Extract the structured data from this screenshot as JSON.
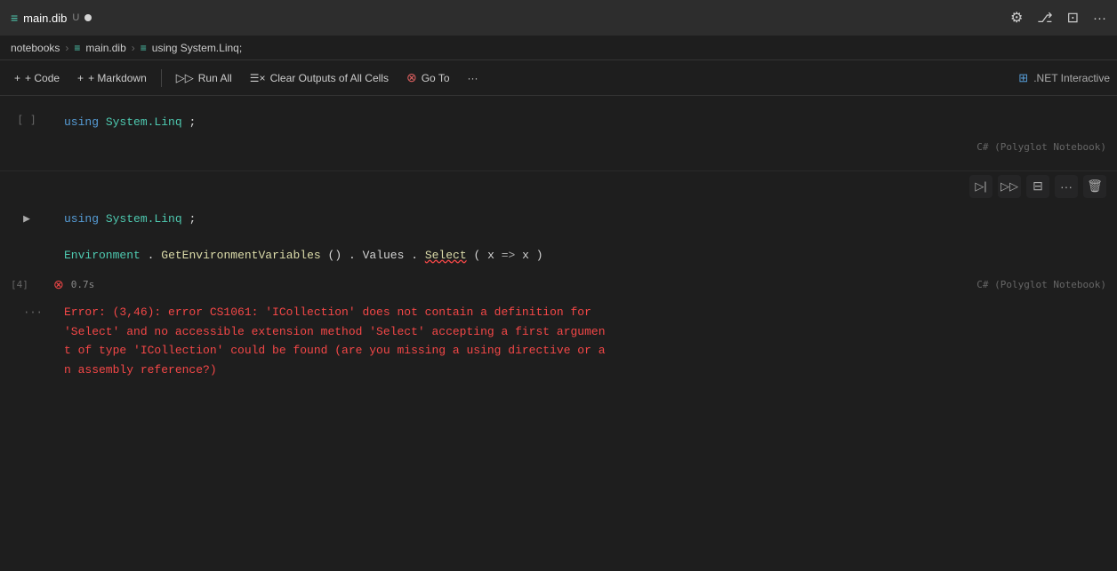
{
  "titlebar": {
    "filename": "main.dib",
    "modified_flag": "U",
    "icons": [
      "gear-icon",
      "branch-icon",
      "layout-icon",
      "more-icon"
    ]
  },
  "breadcrumb": {
    "items": [
      "notebooks",
      "main.dib",
      "using System.Linq;"
    ],
    "separators": [
      ">",
      ">"
    ]
  },
  "toolbar": {
    "add_code_label": "+ Code",
    "add_markdown_label": "+ Markdown",
    "run_all_label": "Run All",
    "clear_outputs_label": "Clear Outputs of All Cells",
    "goto_label": "Go To",
    "more_label": "...",
    "net_interactive_label": ".NET Interactive"
  },
  "cell1": {
    "gutter_label": "[ ]",
    "code_line": "using System.Linq;",
    "footer_label": "C# (Polyglot Notebook)"
  },
  "cell2": {
    "run_icon": "▶",
    "gutter_label": "[4]",
    "code_lines": [
      "using System.Linq;",
      "",
      "Environment.GetEnvironmentVariables().Values.Select(x => x)"
    ],
    "footer_label": "C# (Polyglot Notebook)",
    "time_label": "0.7s",
    "toolbar_buttons": [
      "run-cell-icon",
      "run-next-icon",
      "split-cell-icon",
      "more-icon",
      "delete-icon"
    ]
  },
  "error_cell": {
    "gutter_label": "...",
    "message": "Error: (3,46): error CS1061: 'ICollection' does not contain a definition for\n'Select' and no accessible extension method 'Select' accepting a first argumen\nt of type 'ICollection' could be found (are you missing a using directive or a\nn assembly reference?)"
  }
}
